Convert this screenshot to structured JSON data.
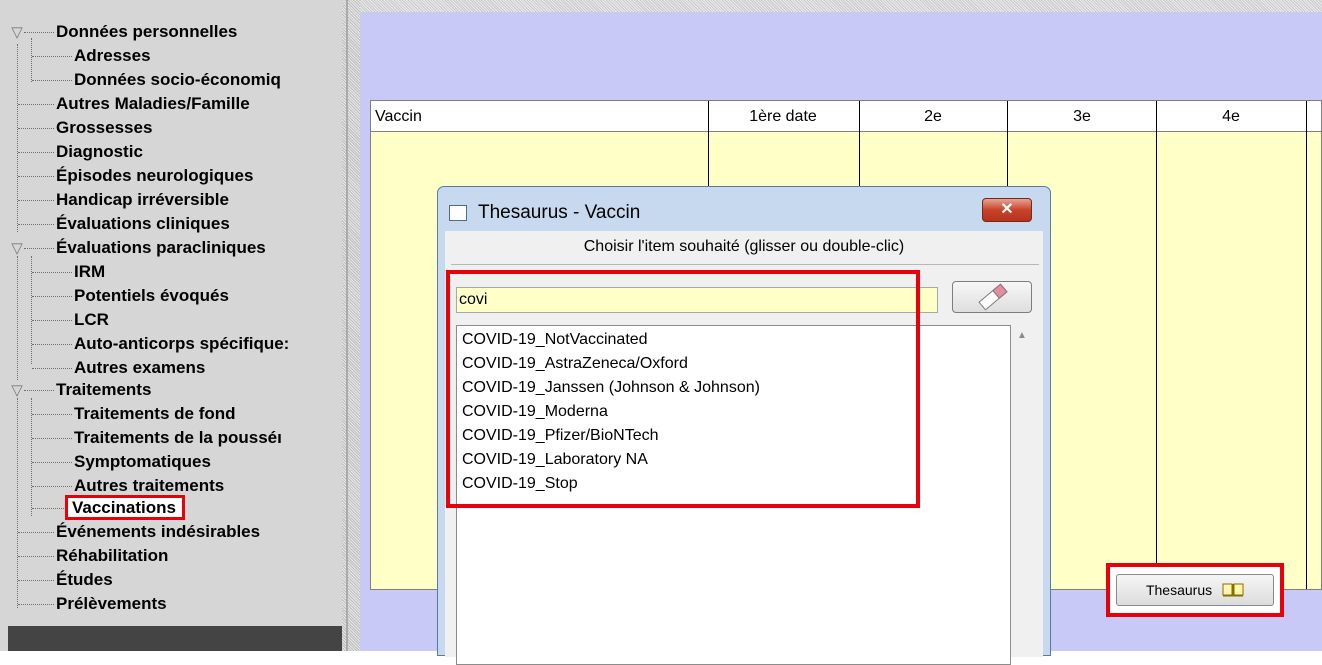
{
  "tree": {
    "items": [
      {
        "label": "Données personnelles"
      },
      {
        "label": "Adresses"
      },
      {
        "label": "Données socio-économiq"
      },
      {
        "label": "Autres Maladies/Famille"
      },
      {
        "label": "Grossesses"
      },
      {
        "label": "Diagnostic"
      },
      {
        "label": "Épisodes neurologiques"
      },
      {
        "label": "Handicap irréversible"
      },
      {
        "label": "Évaluations cliniques"
      },
      {
        "label": "Évaluations paracliniques"
      },
      {
        "label": "IRM"
      },
      {
        "label": "Potentiels évoqués"
      },
      {
        "label": "LCR"
      },
      {
        "label": "Auto-anticorps spécifique:"
      },
      {
        "label": "Autres examens"
      },
      {
        "label": "Traitements"
      },
      {
        "label": "Traitements de fond"
      },
      {
        "label": "Traitements de la pousséı"
      },
      {
        "label": "Symptomatiques"
      },
      {
        "label": "Autres traitements"
      },
      {
        "label": "Vaccinations"
      },
      {
        "label": "Événements indésirables"
      },
      {
        "label": "Réhabilitation"
      },
      {
        "label": "Études"
      },
      {
        "label": "Prélèvements"
      }
    ]
  },
  "grid": {
    "columns": [
      "Vaccin",
      "1ère date",
      "2e",
      "3e",
      "4e"
    ]
  },
  "dialog": {
    "title": "Thesaurus - Vaccin",
    "close_label": "✕",
    "instruction": "Choisir l'item souhaité (glisser ou double-clic)",
    "search_value": "covi",
    "results": [
      "COVID-19_NotVaccinated",
      "COVID-19_AstraZeneca/Oxford",
      "COVID-19_Janssen (Johnson & Johnson)",
      "COVID-19_Moderna",
      "COVID-19_Pfizer/BioNTech",
      "COVID-19_Laboratory NA",
      "COVID-19_Stop"
    ]
  },
  "thesaurus_button": {
    "label": "Thesaurus"
  },
  "colors": {
    "highlight": "#e8000b",
    "content_bg": "#c9c9f8",
    "grid_bg": "#ffffc8",
    "tree_bg": "#d6d6d6"
  }
}
